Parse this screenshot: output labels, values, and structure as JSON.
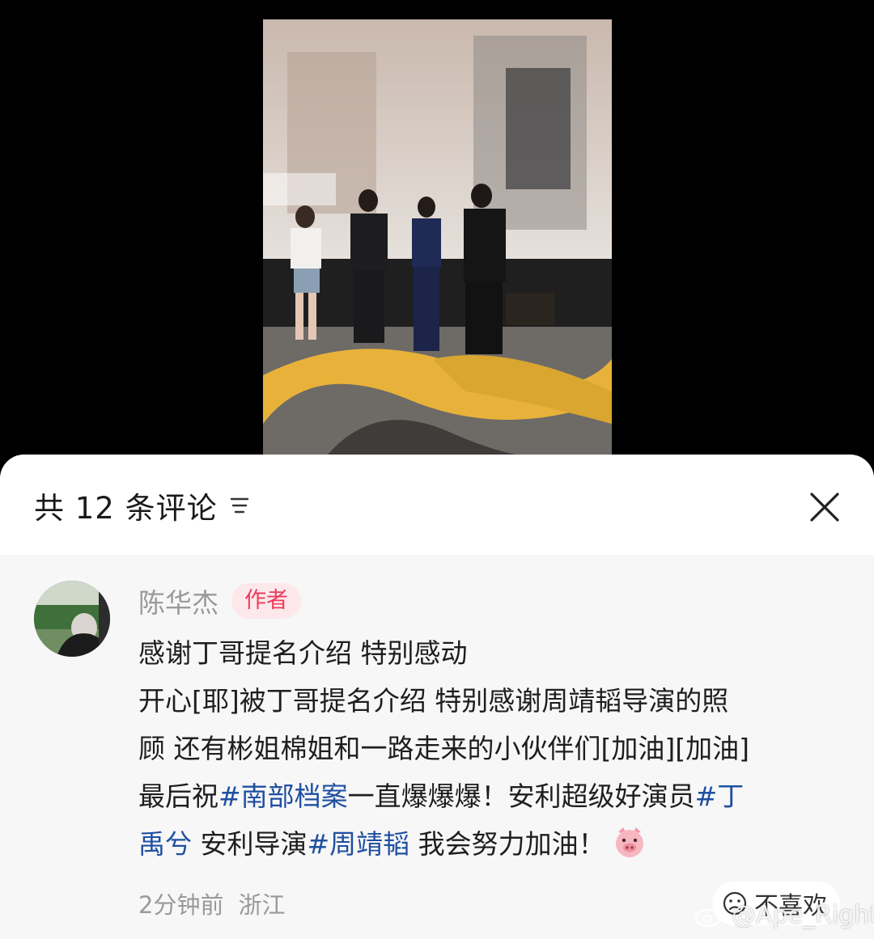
{
  "sheet": {
    "title": "共 12 条评论",
    "sort_icon": "sort-filter-icon",
    "close_icon": "close-icon"
  },
  "comment": {
    "username": "陈华杰",
    "badge": "作者",
    "lines": [
      [
        {
          "t": "感谢丁哥提名介绍 特别感动"
        }
      ],
      [
        {
          "t": "开心[耶]被丁哥提名介绍  特别感谢周靖韬导演的照"
        }
      ],
      [
        {
          "t": "顾 还有彬姐棉姐和一路走来的小伙伴们[加油][加油]"
        }
      ],
      [
        {
          "t": "最后祝"
        },
        {
          "t": "#南部档案",
          "tag": true
        },
        {
          "t": "一直爆爆爆！安利超级好演员"
        },
        {
          "t": "#丁",
          "tag": true
        }
      ],
      [
        {
          "t": "禹兮",
          "tag": true
        },
        {
          "t": "  安利导演"
        },
        {
          "t": "#周靖韬",
          "tag": true
        },
        {
          "t": "   我会努力加油！"
        }
      ]
    ],
    "emoji": "pig-face-emoji",
    "time": "2分钟前",
    "location": "浙江",
    "dislike_label": "不喜欢"
  },
  "watermark": "@Ape_Right",
  "colors": {
    "tag": "#1f4fa0",
    "badge_text": "#ee3b5b",
    "badge_bg": "#fde8ec",
    "sheet_bg": "#f7f7f7"
  }
}
